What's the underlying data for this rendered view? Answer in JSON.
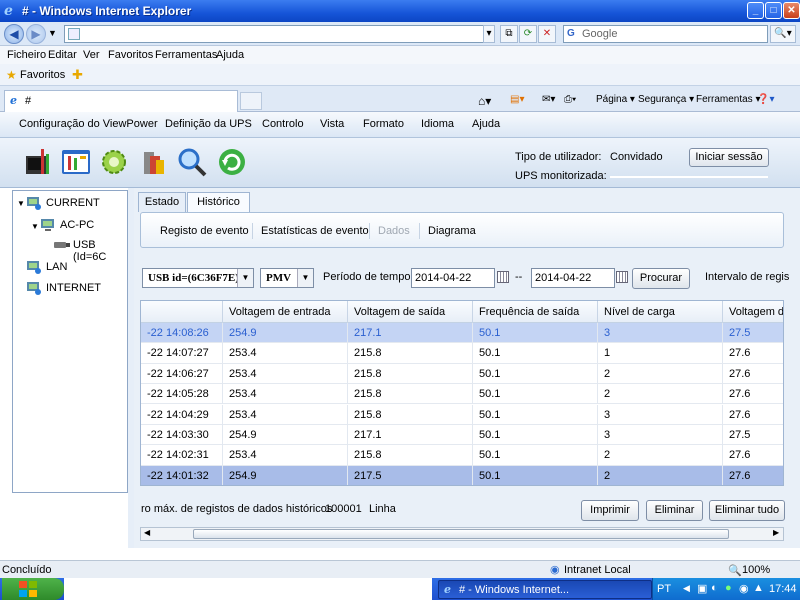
{
  "window": {
    "title": "# - Windows Internet Explorer"
  },
  "browser": {
    "search_placeholder": "Google",
    "menu": [
      "Ficheiro",
      "Editar",
      "Ver",
      "Favoritos",
      "Ferramentas",
      "Ajuda"
    ],
    "favorites_label": "Favoritos",
    "tab_title": "#",
    "commands": {
      "page": "Página",
      "security": "Segurança",
      "tools": "Ferramentas"
    }
  },
  "app": {
    "menu": [
      "Configuração do ViewPower",
      "Definição da UPS",
      "Controlo",
      "Vista",
      "Formato",
      "Idioma",
      "Ajuda"
    ],
    "user": {
      "type_label": "Tipo de utilizador:",
      "type_value": "Convidado",
      "ups_label": "UPS monitorizada:",
      "login_button": "Iniciar sessão"
    },
    "tree": {
      "current": "CURRENT",
      "pc": "AC-PC",
      "usb": "USB (Id=6C",
      "lan": "LAN",
      "internet": "INTERNET"
    },
    "tabs": {
      "estado": "Estado",
      "historico": "Histórico"
    },
    "subtabs": [
      "Registo de evento",
      "Estatísticas de evento",
      "Dados",
      "Diagrama"
    ],
    "filter": {
      "device": "USB id=(6C36F7E)",
      "model": "PMV",
      "period_label": "Período de tempo",
      "from": "2014-04-22",
      "sep": "--",
      "to": "2014-04-22",
      "search_button": "Procurar",
      "interval_label": "Intervalo de regis"
    },
    "table": {
      "headers": [
        "",
        "Voltagem de entrada",
        "Voltagem de saída",
        "Frequência de saída",
        "Nível de carga",
        "Voltagem de"
      ],
      "rows": [
        [
          "-22 14:08:26",
          "254.9",
          "217.1",
          "50.1",
          "3",
          "27.5"
        ],
        [
          "-22 14:07:27",
          "253.4",
          "215.8",
          "50.1",
          "1",
          "27.6"
        ],
        [
          "-22 14:06:27",
          "253.4",
          "215.8",
          "50.1",
          "2",
          "27.6"
        ],
        [
          "-22 14:05:28",
          "253.4",
          "215.8",
          "50.1",
          "2",
          "27.6"
        ],
        [
          "-22 14:04:29",
          "253.4",
          "215.8",
          "50.1",
          "3",
          "27.6"
        ],
        [
          "-22 14:03:30",
          "254.9",
          "217.1",
          "50.1",
          "3",
          "27.5"
        ],
        [
          "-22 14:02:31",
          "253.4",
          "215.8",
          "50.1",
          "2",
          "27.6"
        ],
        [
          "-22 14:01:32",
          "254.9",
          "217.5",
          "50.1",
          "2",
          "27.6"
        ]
      ]
    },
    "bottom": {
      "max_label": "ro máx. de registos de dados históricos",
      "max_value": "100001",
      "unit": "Linha",
      "print": "Imprimir",
      "delete": "Eliminar",
      "delete_all": "Eliminar tudo"
    }
  },
  "status": {
    "text": "Concluído",
    "zone": "Intranet Local",
    "zoom": "100%"
  },
  "taskbar": {
    "task": "# - Windows Internet...",
    "lang": "PT",
    "time": "17:44"
  }
}
